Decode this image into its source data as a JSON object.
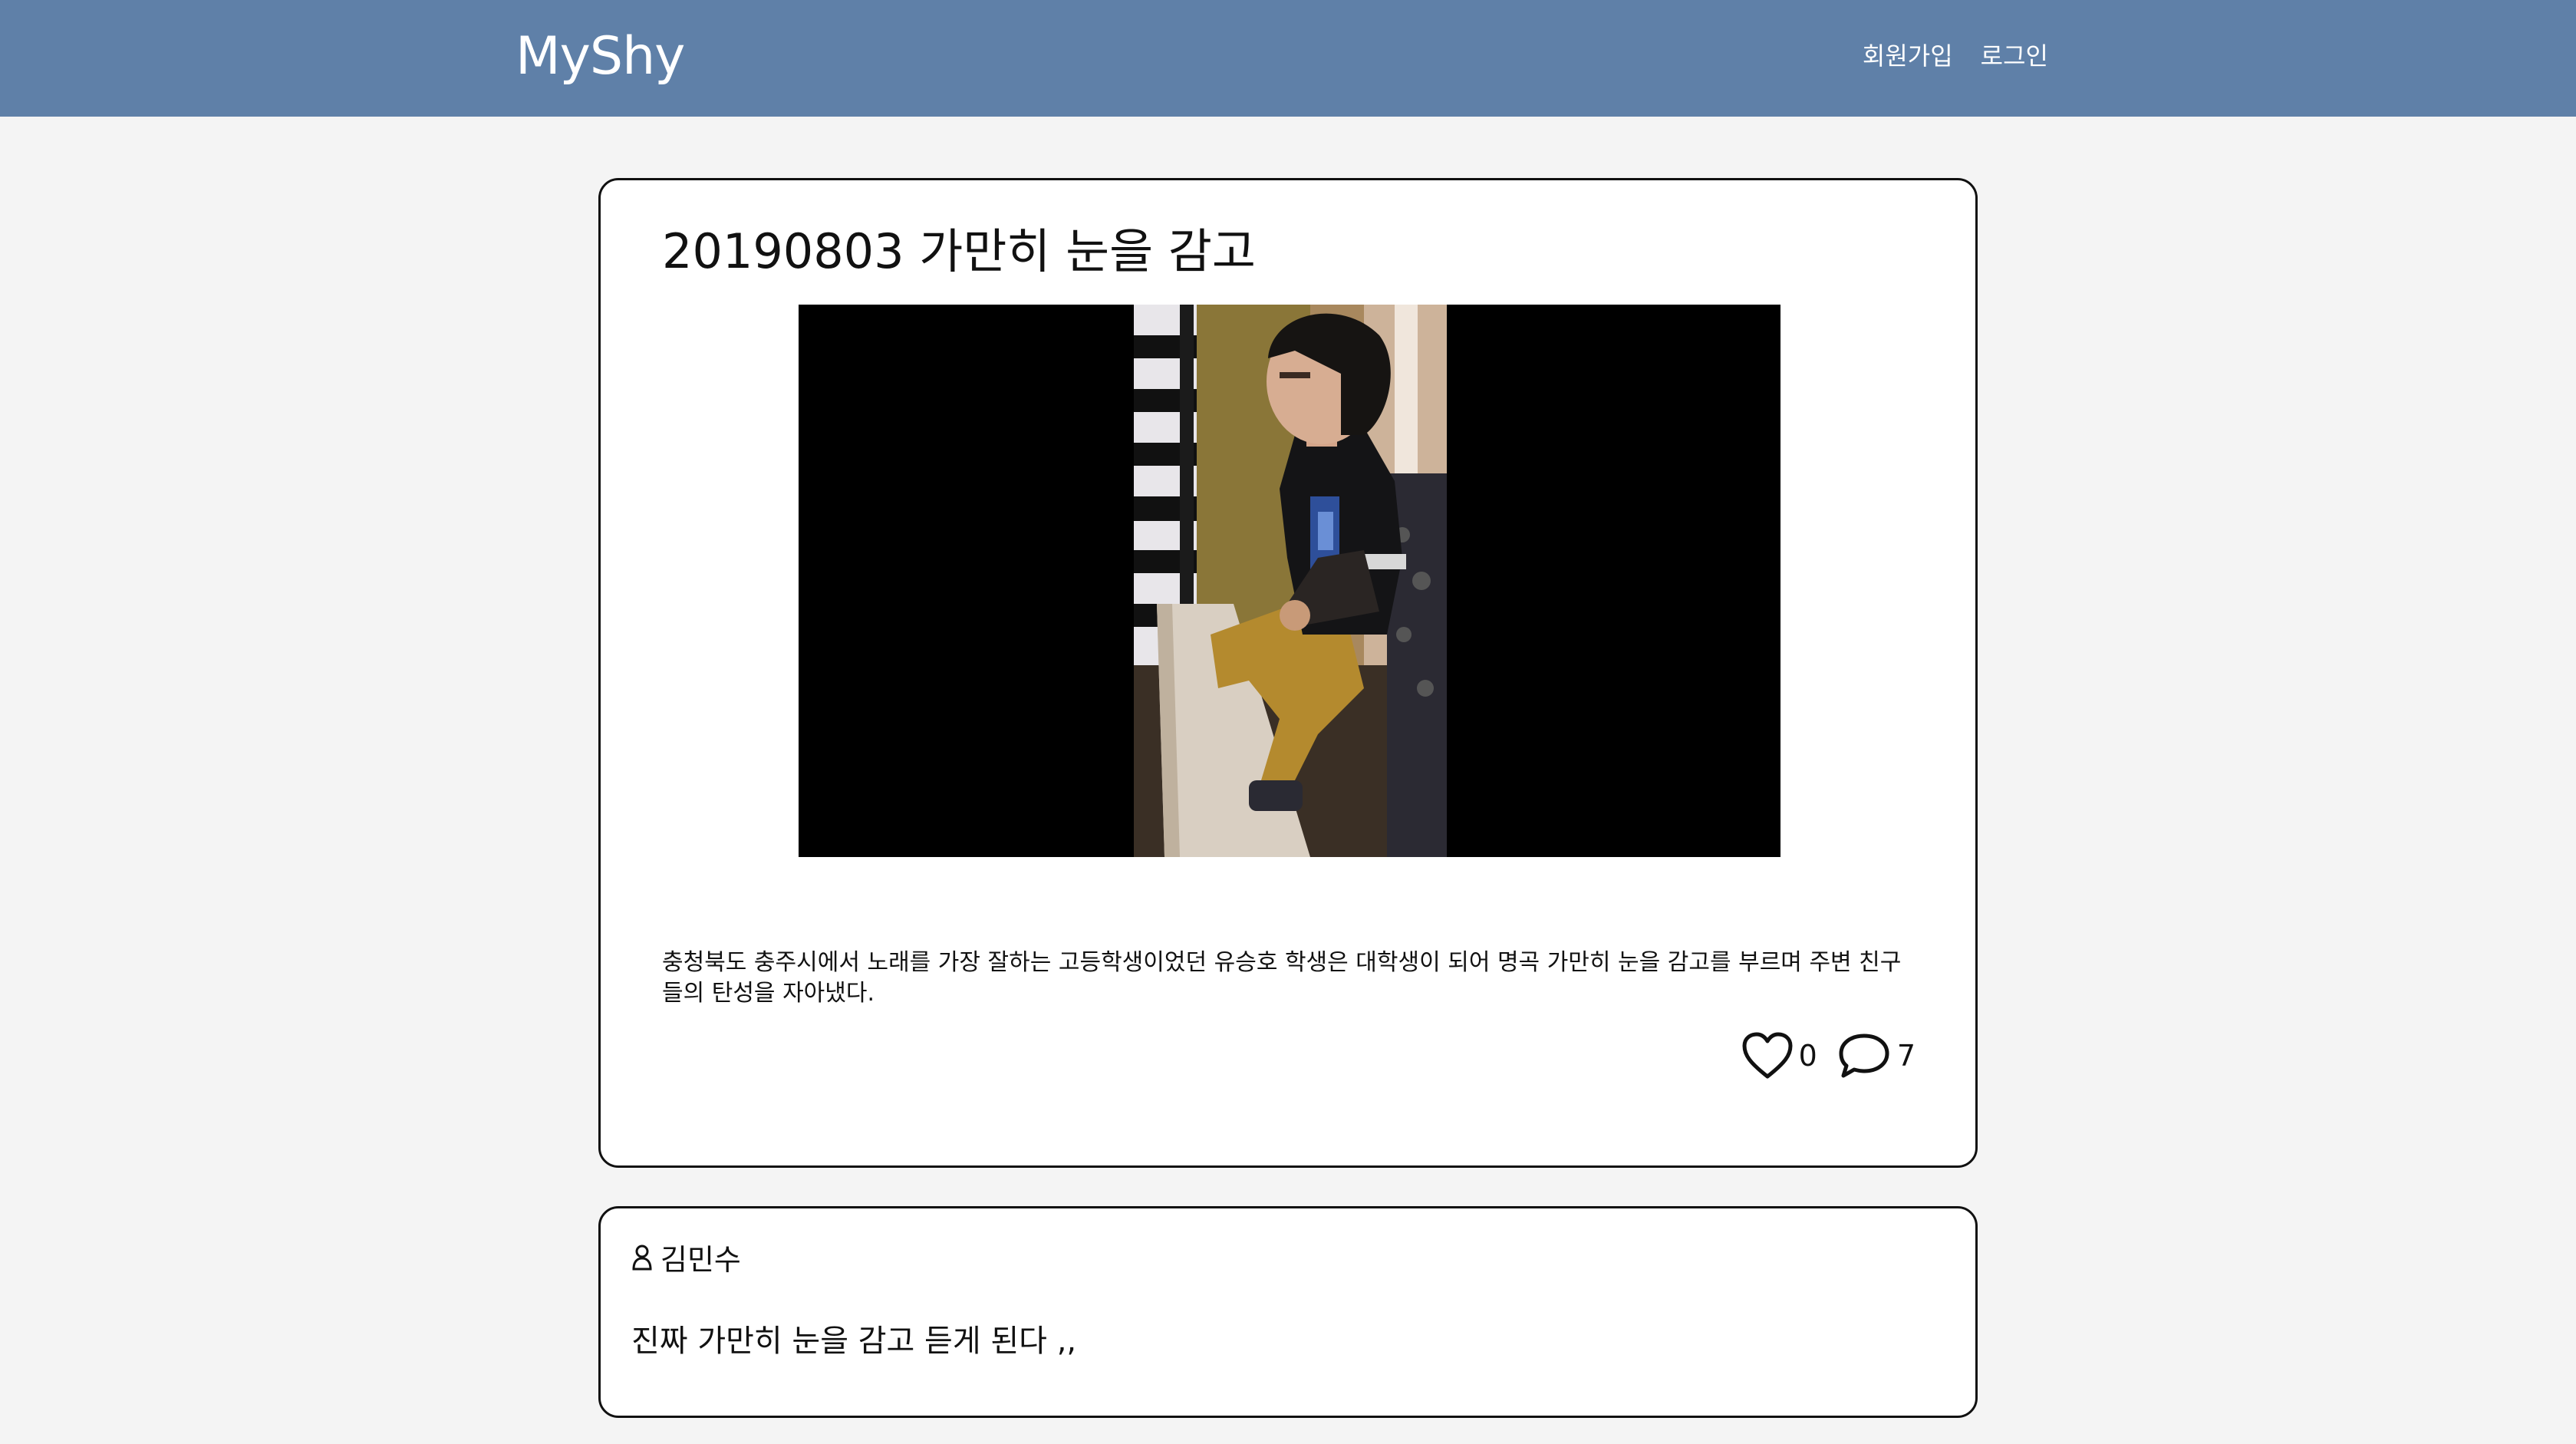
{
  "header": {
    "brand": "MyShy",
    "nav": [
      {
        "label": "회원가입",
        "icon": null
      },
      {
        "label": "로그인",
        "icon": null
      }
    ]
  },
  "post": {
    "title": "20190803 가만히 눈을 감고",
    "video": {
      "thumbnail": "video-still-person-seated"
    },
    "body": "충청북도 충주시에서 노래를 가장 잘하는 고등학생이었던 유승호 학생은 대학생이 되어 명곡 가만히 눈을 감고를 부르며 주변 친구들의 탄성을 자아냈다.",
    "likes": "0",
    "comments": "7",
    "like_icon": "heart-icon",
    "comment_icon": "speech-bubble-icon"
  },
  "comment": {
    "author": "김민수",
    "author_icon": "user-icon",
    "text": "진짜 가만히 눈을 감고 듣게 된다 ,,"
  },
  "colors": {
    "header_bg": "#5f80a8",
    "page_bg": "#f4f4f4",
    "card_bg": "#ffffff"
  }
}
